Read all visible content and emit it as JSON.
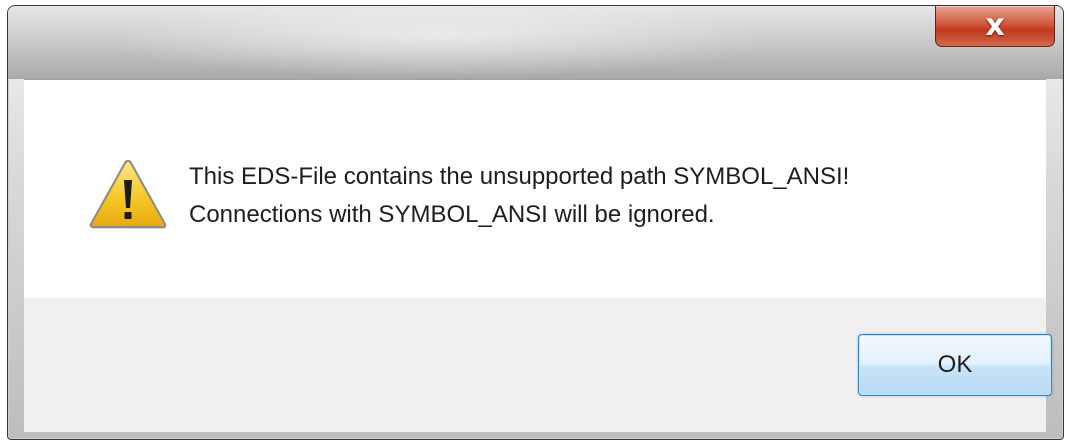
{
  "window": {
    "title": "",
    "close_glyph": "x",
    "close_icon": "close-icon"
  },
  "message": {
    "icon": "warning-icon",
    "line1": "This EDS-File contains the unsupported path SYMBOL_ANSI!",
    "line2": "Connections with SYMBOL_ANSI will be ignored."
  },
  "buttons": {
    "ok_label": "OK"
  },
  "colors": {
    "close_button": "#c13a1f",
    "ok_border": "#3c7fb1",
    "warning_fill": "#f5c928",
    "footer_bg": "#f0f0f0"
  }
}
